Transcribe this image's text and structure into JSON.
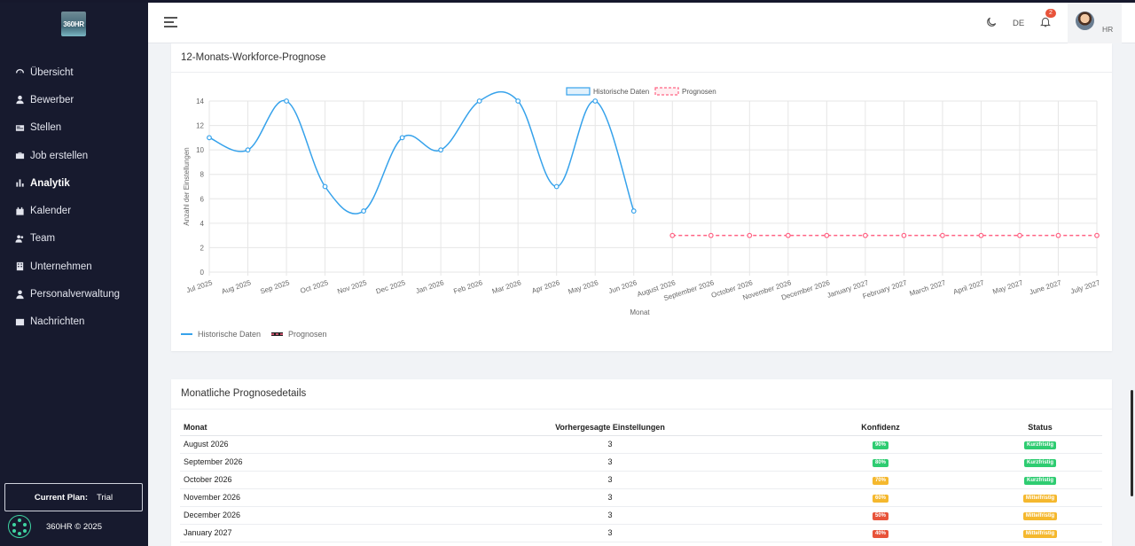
{
  "brand": {
    "logo_text": "360HR"
  },
  "sidebar": {
    "items": [
      {
        "label": "Übersicht",
        "icon": "gauge-icon"
      },
      {
        "label": "Bewerber",
        "icon": "user-icon"
      },
      {
        "label": "Stellen",
        "icon": "card-icon"
      },
      {
        "label": "Job erstellen",
        "icon": "briefcase-icon"
      },
      {
        "label": "Analytik",
        "icon": "bar-chart-icon",
        "active": true
      },
      {
        "label": "Kalender",
        "icon": "calendar-icon"
      },
      {
        "label": "Team",
        "icon": "users-icon"
      },
      {
        "label": "Unternehmen",
        "icon": "building-icon"
      },
      {
        "label": "Personalverwaltung",
        "icon": "user-tie-icon"
      },
      {
        "label": "Nachrichten",
        "icon": "inbox-icon"
      }
    ],
    "plan_label": "Current Plan:",
    "plan_value": "Trial",
    "copyright": "360HR © 2025"
  },
  "header": {
    "language": "DE",
    "notification_count": "2",
    "user_initials": "HR"
  },
  "forecast_card": {
    "title": "12-Monats-Workforce-Prognose"
  },
  "chart_data": {
    "type": "line",
    "categories": [
      "Jul 2025",
      "Aug 2025",
      "Sep 2025",
      "Oct 2025",
      "Nov 2025",
      "Dec 2025",
      "Jan 2026",
      "Feb 2026",
      "Mar 2026",
      "Apr 2026",
      "May 2026",
      "Jun 2026",
      "August 2026",
      "September 2026",
      "October 2026",
      "November 2026",
      "December 2026",
      "January 2027",
      "February 2027",
      "March 2027",
      "April 2027",
      "May 2027",
      "June 2027",
      "July 2027"
    ],
    "series": [
      {
        "name": "Historische Daten",
        "color": "#36a2eb",
        "values": [
          11,
          10,
          14,
          7,
          5,
          11,
          10,
          14,
          14,
          7,
          14,
          5,
          null,
          null,
          null,
          null,
          null,
          null,
          null,
          null,
          null,
          null,
          null,
          null
        ]
      },
      {
        "name": "Prognosen",
        "color": "#ff6384",
        "dashed": true,
        "values": [
          null,
          null,
          null,
          null,
          null,
          null,
          null,
          null,
          null,
          null,
          null,
          null,
          3,
          3,
          3,
          3,
          3,
          3,
          3,
          3,
          3,
          3,
          3,
          3
        ]
      }
    ],
    "xlabel": "Monat",
    "ylabel": "Anzahl der Einstellungen",
    "ylim": [
      0,
      14
    ],
    "yticks": [
      0,
      2,
      4,
      6,
      8,
      10,
      12,
      14
    ],
    "grid": true,
    "legend": "top",
    "bottom_legend": [
      "Historische Daten",
      "Prognosen"
    ]
  },
  "details_card": {
    "title": "Monatliche Prognosedetails",
    "columns": [
      "Monat",
      "Vorhergesagte Einstellungen",
      "Konfidenz",
      "Status"
    ],
    "rows": [
      {
        "month": "August 2026",
        "hires": "3",
        "confidence": "90%",
        "conf_color": "#2ecc71",
        "status": "Kurzfristig",
        "status_color": "#2ecc71"
      },
      {
        "month": "September 2026",
        "hires": "3",
        "confidence": "80%",
        "conf_color": "#2ecc71",
        "status": "Kurzfristig",
        "status_color": "#2ecc71"
      },
      {
        "month": "October 2026",
        "hires": "3",
        "confidence": "70%",
        "conf_color": "#f5b82e",
        "status": "Kurzfristig",
        "status_color": "#2ecc71"
      },
      {
        "month": "November 2026",
        "hires": "3",
        "confidence": "60%",
        "conf_color": "#f5b82e",
        "status": "Mittelfristig",
        "status_color": "#f5b82e"
      },
      {
        "month": "December 2026",
        "hires": "3",
        "confidence": "50%",
        "conf_color": "#e8533a",
        "status": "Mittelfristig",
        "status_color": "#f5b82e"
      },
      {
        "month": "January 2027",
        "hires": "3",
        "confidence": "40%",
        "conf_color": "#e8533a",
        "status": "Mittelfristig",
        "status_color": "#f5b82e"
      }
    ]
  }
}
